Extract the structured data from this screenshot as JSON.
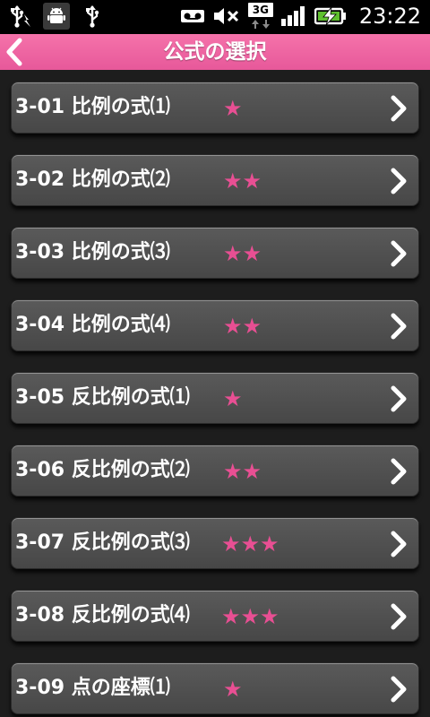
{
  "status_bar": {
    "time": "23:22",
    "network": "3G",
    "icons": [
      "usb-debug-icon",
      "android-icon",
      "usb-icon",
      "voicemail-icon",
      "mute-icon",
      "3g-icon",
      "signal-icon",
      "battery-charging-icon"
    ]
  },
  "header": {
    "title": "公式の選択",
    "accent_color": "#f06aa5"
  },
  "items": [
    {
      "label": "3-01 比例の式⑴",
      "stars": "★"
    },
    {
      "label": "3-02 比例の式⑵",
      "stars": "★★"
    },
    {
      "label": "3-03 比例の式⑶",
      "stars": "★★"
    },
    {
      "label": "3-04 比例の式⑷",
      "stars": "★★"
    },
    {
      "label": "3-05 反比例の式⑴",
      "stars": "★"
    },
    {
      "label": "3-06 反比例の式⑵",
      "stars": "★★"
    },
    {
      "label": "3-07 反比例の式⑶",
      "stars": "★★★"
    },
    {
      "label": "3-08 反比例の式⑷",
      "stars": "★★★"
    },
    {
      "label": "3-09 点の座標⑴",
      "stars": "★"
    }
  ],
  "star_color": "#e84f93"
}
